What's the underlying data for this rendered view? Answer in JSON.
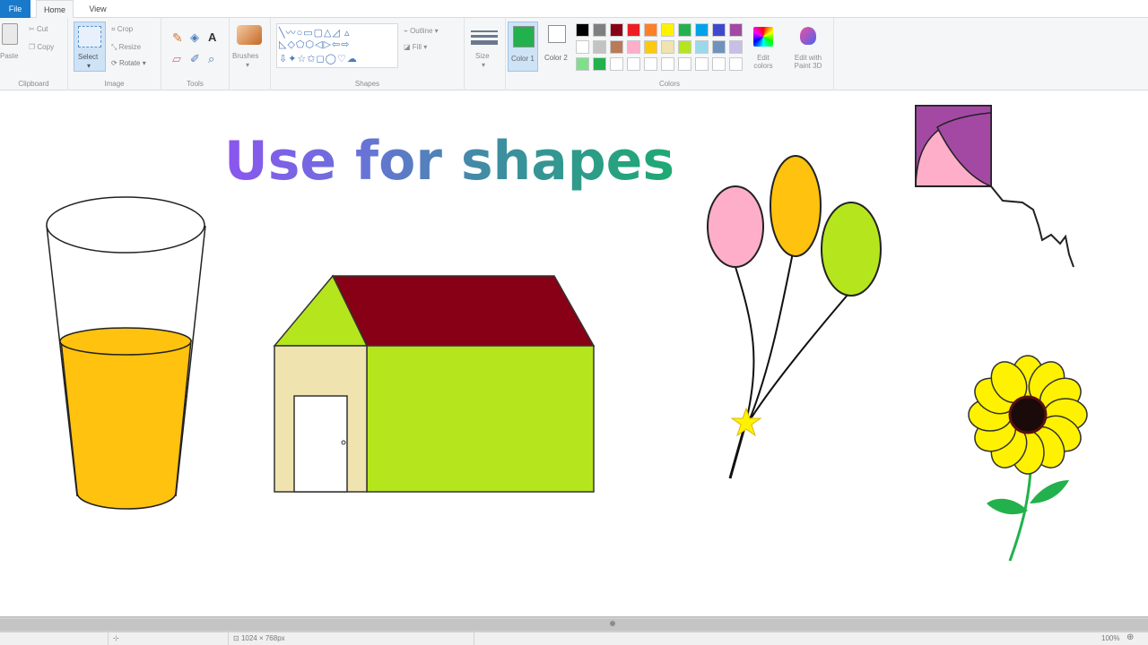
{
  "tabs": {
    "file": "File",
    "home": "Home",
    "view": "View"
  },
  "ribbon": {
    "clipboard": {
      "paste": "Paste",
      "cut": "Cut",
      "copy": "Copy",
      "label": "Clipboard"
    },
    "image": {
      "select": "Select",
      "crop": "Crop",
      "resize": "Resize",
      "rotate": "Rotate",
      "label": "Image"
    },
    "tools": {
      "label": "Tools"
    },
    "brushes": {
      "label": "Brushes"
    },
    "shapes": {
      "outline": "Outline",
      "fill": "Fill",
      "label": "Shapes"
    },
    "size": {
      "label": "Size"
    },
    "colors": {
      "color1": "Color 1",
      "color2": "Color 2",
      "edit": "Edit colors",
      "paint3d": "Edit with Paint 3D",
      "label": "Colors",
      "color1_value": "#22b14c",
      "color2_value": "#ffffff",
      "palette": [
        [
          "#000000",
          "#7f7f7f",
          "#880015",
          "#ed1c24",
          "#ff7f27",
          "#fff200",
          "#22b14c",
          "#00a2e8",
          "#3f48cc",
          "#a349a4"
        ],
        [
          "#ffffff",
          "#c3c3c3",
          "#b97a57",
          "#ffaec9",
          "#ffc90e",
          "#efe4b0",
          "#b5e61d",
          "#99d9ea",
          "#7092be",
          "#c8bfe7"
        ],
        [
          "#7ee08a",
          "#22b14c",
          "#ffffff",
          "#ffffff",
          "#ffffff",
          "#ffffff",
          "#ffffff",
          "#ffffff",
          "#ffffff",
          "#ffffff"
        ]
      ]
    }
  },
  "canvas": {
    "headline": "Use for shapes",
    "colors": {
      "juice": "#ffc20e",
      "roof": "#880015",
      "gable": "#b5e61d",
      "wall": "#b5e61d",
      "side_wall": "#efe4b0",
      "door": "#ffffff",
      "balloon_pink": "#ffaec9",
      "balloon_orange": "#ffc20e",
      "balloon_green": "#b5e61d",
      "star": "#fff200",
      "kite_pink": "#ffaec9",
      "kite_purple": "#a349a4",
      "petal": "#fff200",
      "flower_center": "#1a0a0a",
      "stem": "#22b14c"
    }
  },
  "status": {
    "cursor": "",
    "size": "1024 × 768px",
    "zoom": "100%"
  }
}
